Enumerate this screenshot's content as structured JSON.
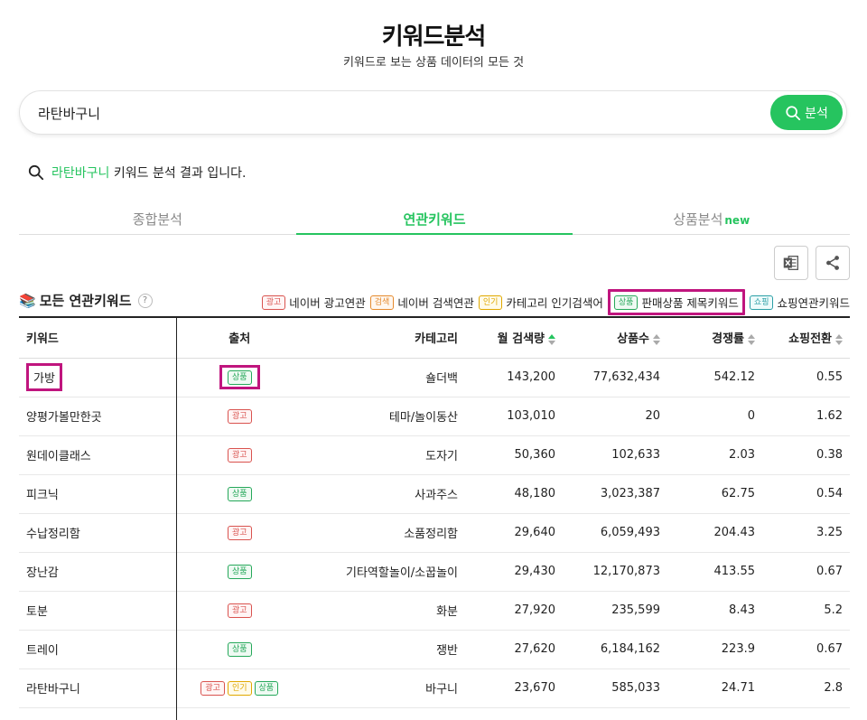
{
  "header": {
    "title": "키워드분석",
    "subtitle": "키워드로 보는 상품 데이터의 모든 것"
  },
  "search": {
    "value": "라탄바구니",
    "button_label": "분석"
  },
  "result": {
    "keyword": "라탄바구니",
    "suffix": "키워드 분석 결과 입니다."
  },
  "tabs": [
    {
      "label": "종합분석",
      "active": false
    },
    {
      "label": "연관키워드",
      "active": true
    },
    {
      "label": "상품분석",
      "badge": "new",
      "active": false
    }
  ],
  "section": {
    "icon": "📚",
    "title": "모든 연관키워드",
    "help": "?"
  },
  "legend": [
    {
      "badge": "광고",
      "label": "네이버 광고연관",
      "kind": "ad"
    },
    {
      "badge": "검색",
      "label": "네이버 검색연관",
      "kind": "search"
    },
    {
      "badge": "인기",
      "label": "카테고리 인기검색어",
      "kind": "pop"
    },
    {
      "badge": "상품",
      "label": "판매상품 제목키워드",
      "kind": "prod"
    },
    {
      "badge": "쇼핑",
      "label": "쇼핑연관키워드",
      "kind": "shop"
    }
  ],
  "table": {
    "headers": [
      "키워드",
      "출처",
      "카테고리",
      "월 검색량",
      "상품수",
      "경쟁률",
      "쇼핑전환"
    ],
    "rows": [
      {
        "keyword": "가방",
        "sources": [
          "상품"
        ],
        "category": "숄더백",
        "search": "143,200",
        "products": "77,632,434",
        "competition": "542.12",
        "conversion": "0.55"
      },
      {
        "keyword": "양평가볼만한곳",
        "sources": [
          "광고"
        ],
        "category": "테마/놀이동산",
        "search": "103,010",
        "products": "20",
        "competition": "0",
        "conversion": "1.62"
      },
      {
        "keyword": "원데이클래스",
        "sources": [
          "광고"
        ],
        "category": "도자기",
        "search": "50,360",
        "products": "102,633",
        "competition": "2.03",
        "conversion": "0.38"
      },
      {
        "keyword": "피크닉",
        "sources": [
          "상품"
        ],
        "category": "사과주스",
        "search": "48,180",
        "products": "3,023,387",
        "competition": "62.75",
        "conversion": "0.54"
      },
      {
        "keyword": "수납정리함",
        "sources": [
          "광고"
        ],
        "category": "소품정리함",
        "search": "29,640",
        "products": "6,059,493",
        "competition": "204.43",
        "conversion": "3.25"
      },
      {
        "keyword": "장난감",
        "sources": [
          "상품"
        ],
        "category": "기타역할놀이/소꿉놀이",
        "search": "29,430",
        "products": "12,170,873",
        "competition": "413.55",
        "conversion": "0.67"
      },
      {
        "keyword": "토분",
        "sources": [
          "광고"
        ],
        "category": "화분",
        "search": "27,920",
        "products": "235,599",
        "competition": "8.43",
        "conversion": "5.2"
      },
      {
        "keyword": "트레이",
        "sources": [
          "상품"
        ],
        "category": "쟁반",
        "search": "27,620",
        "products": "6,184,162",
        "competition": "223.9",
        "conversion": "0.67"
      },
      {
        "keyword": "라탄바구니",
        "sources": [
          "광고",
          "인기",
          "상품"
        ],
        "category": "바구니",
        "search": "23,670",
        "products": "585,033",
        "competition": "24.71",
        "conversion": "2.8"
      }
    ]
  },
  "colors": {
    "accent": "#26c45f",
    "highlight": "#c0157e"
  }
}
